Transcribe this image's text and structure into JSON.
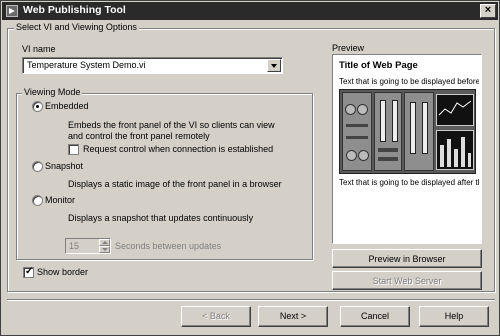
{
  "window": {
    "title": "Web Publishing Tool"
  },
  "main_group": {
    "title": "Select VI and Viewing Options"
  },
  "vi_name": {
    "label": "VI name",
    "value": "Temperature System Demo.vi"
  },
  "viewing_mode": {
    "title": "Viewing Mode",
    "embedded": {
      "label": "Embedded",
      "description_line1": "Embeds the front panel of the VI so clients can view",
      "description_line2": "and control the front panel remotely",
      "selected": true
    },
    "request_control": {
      "label": "Request control when connection is established",
      "checked": false
    },
    "snapshot": {
      "label": "Snapshot",
      "description": "Displays a static image of the front panel in a browser",
      "selected": false
    },
    "monitor": {
      "label": "Monitor",
      "description": "Displays a snapshot that updates continuously",
      "selected": false
    },
    "update_interval": {
      "value": "15",
      "label": "Seconds between updates"
    }
  },
  "show_border": {
    "label": "Show border",
    "checked": true
  },
  "preview": {
    "label": "Preview",
    "page_title": "Title of Web Page",
    "text_before": "Text that is going to be displayed before ...",
    "text_after": "Text that is going to be displayed after th..."
  },
  "buttons": {
    "preview_browser": "Preview in Browser",
    "start_server": "Start Web Server",
    "back": "< Back",
    "next": "Next >",
    "cancel": "Cancel",
    "help": "Help"
  }
}
